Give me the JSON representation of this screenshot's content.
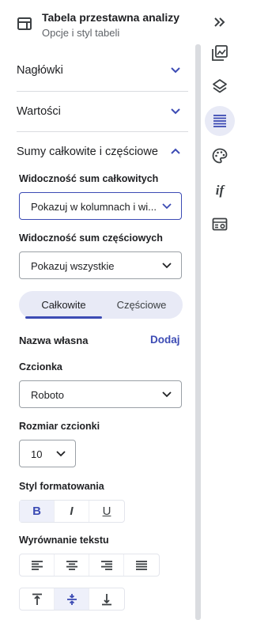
{
  "header": {
    "title": "Tabela przestawna analizy",
    "subtitle": "Opcje i styl tabeli"
  },
  "sections": {
    "headers_label": "Nagłówki",
    "values_label": "Wartości",
    "totals_label": "Sumy całkowite i częściowe"
  },
  "totals": {
    "grand_visibility_label": "Widoczność sum całkowitych",
    "grand_visibility_value": "Pokazuj w kolumnach i wi...",
    "sub_visibility_label": "Widoczność sum częściowych",
    "sub_visibility_value": "Pokazuj wszystkie",
    "tabs": [
      {
        "label": "Całkowite",
        "active": true
      },
      {
        "label": "Częściowe",
        "active": false
      }
    ],
    "custom_name_label": "Nazwa własna",
    "add_link": "Dodaj",
    "font_label": "Czcionka",
    "font_value": "Roboto",
    "font_size_label": "Rozmiar czcionki",
    "font_size_value": "10",
    "format_style_label": "Styl formatowania",
    "format_buttons": [
      "B",
      "I",
      "U"
    ],
    "text_align_label": "Wyrównanie tekstu"
  },
  "icons": {
    "collapse": "double-chevron-right-icon",
    "rail": [
      "image-icon",
      "layers-icon",
      "list-lines-icon",
      "palette-icon",
      "if-icon",
      "settings-table-icon"
    ]
  },
  "colors": {
    "accent": "#3c4bb4",
    "accent_light": "#e8eaf6",
    "text": "#202124",
    "muted": "#5f6368"
  }
}
